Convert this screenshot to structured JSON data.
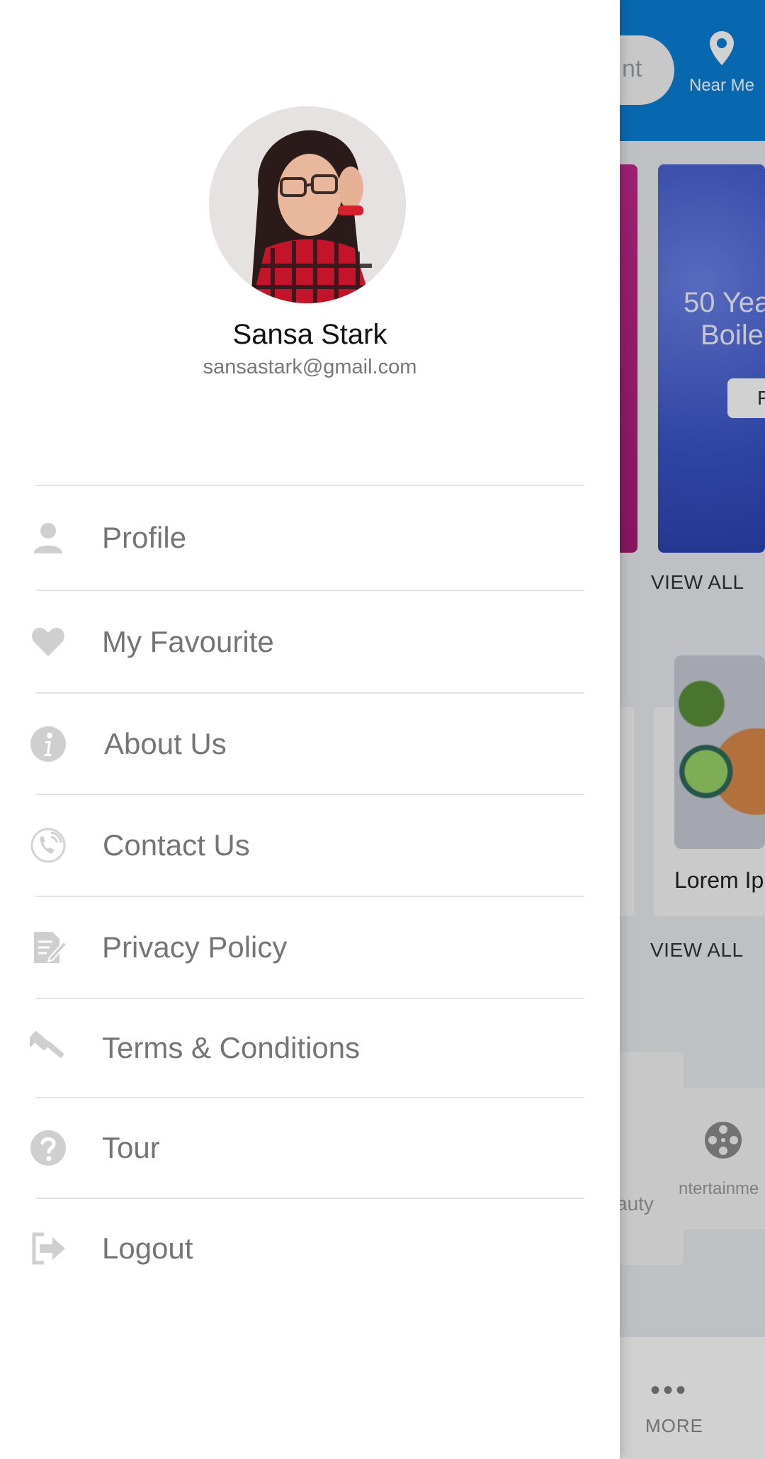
{
  "background_app": {
    "search_partial_text": "nt",
    "near_me_label": "Near Me",
    "banner_text_line1": "50 Yea",
    "banner_text_line2": "Boile",
    "banner_button_partial": "F",
    "view_all_1": "VIEW ALL",
    "view_all_2": "VIEW ALL",
    "card_title_partial": "Lorem Ip",
    "category_beauty_partial": "auty",
    "category_entertainment_partial": "ntertainme",
    "bottom_more_label": "MORE",
    "bottom_more_dots": "•••"
  },
  "drawer": {
    "user": {
      "name": "Sansa Stark",
      "email": "sansastark@gmail.com"
    },
    "menu": [
      {
        "label": "Profile",
        "icon": "person-icon"
      },
      {
        "label": "My Favourite",
        "icon": "heart-icon"
      },
      {
        "label": "About Us",
        "icon": "info-icon"
      },
      {
        "label": "Contact Us",
        "icon": "phone-icon"
      },
      {
        "label": "Privacy Policy",
        "icon": "document-edit-icon"
      },
      {
        "label": "Terms & Conditions",
        "icon": "gavel-icon"
      },
      {
        "label": "Tour",
        "icon": "help-icon"
      },
      {
        "label": "Logout",
        "icon": "logout-icon"
      }
    ]
  },
  "colors": {
    "header_blue": "#0A7FD6",
    "menu_text": "#757575",
    "icon_gray": "#CFCFCF"
  }
}
